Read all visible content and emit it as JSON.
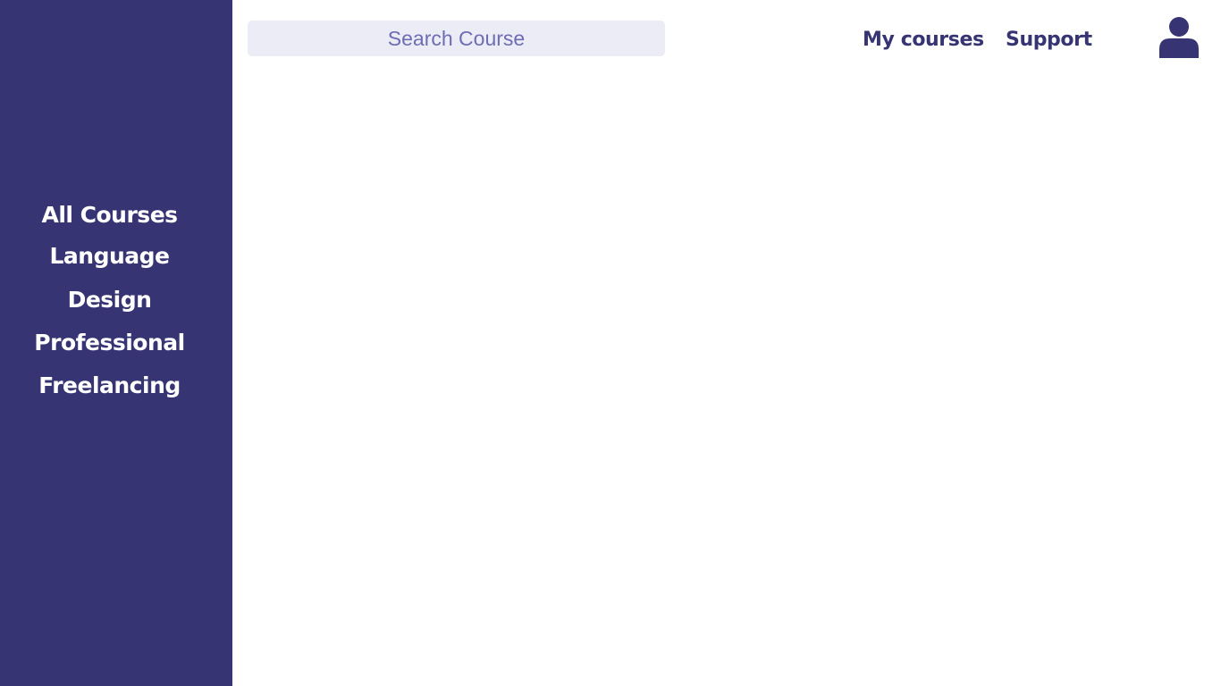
{
  "sidebar": {
    "background": "#373473",
    "items": [
      {
        "label": "All Courses"
      },
      {
        "label": "Language"
      },
      {
        "label": "Design"
      },
      {
        "label": "Professional"
      },
      {
        "label": "Freelancing"
      }
    ]
  },
  "search": {
    "placeholder": "Search Course",
    "value": ""
  },
  "nav": {
    "my_courses": "My courses",
    "support": "Support"
  },
  "user": {
    "icon": "user-avatar-icon"
  },
  "colors": {
    "accent": "#373473",
    "search_bg": "#ececf6",
    "search_text": "#6e6cb3",
    "background": "#ffffff"
  }
}
